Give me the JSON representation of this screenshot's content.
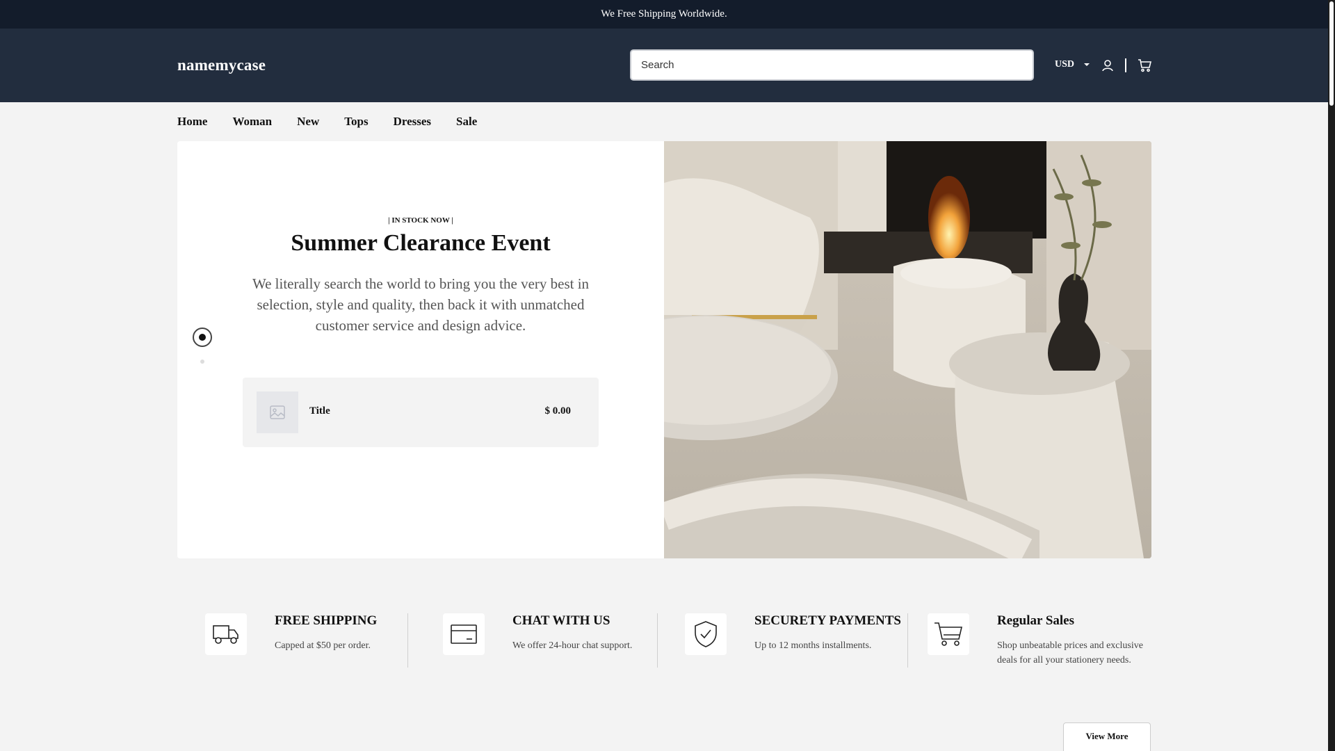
{
  "announcement": "We Free Shipping Worldwide.",
  "header": {
    "logo": "namemycase",
    "search_placeholder": "Search",
    "currency": "USD"
  },
  "nav": {
    "items": [
      "Home",
      "Woman",
      "New",
      "Tops",
      "Dresses",
      "Sale"
    ]
  },
  "hero": {
    "eyebrow": "| IN STOCK NOW |",
    "title": "Summer Clearance Event",
    "text": "We literally search the world to bring you the very best in selection, style and quality, then back it with unmatched customer service and design advice.",
    "product": {
      "title": "Title",
      "price": "$ 0.00"
    }
  },
  "features": [
    {
      "icon": "truck-icon",
      "title": "FREE SHIPPING",
      "desc": "Capped at $50 per order."
    },
    {
      "icon": "credit-card-icon",
      "title": "CHAT WITH US",
      "desc": "We offer 24-hour chat support."
    },
    {
      "icon": "shield-check-icon",
      "title": "SECURETY PAYMENTS",
      "desc": "Up to 12 months installments."
    },
    {
      "icon": "cart-icon",
      "title": "Regular Sales",
      "desc": "Shop unbeatable prices and exclusive deals for all your stationery needs."
    }
  ],
  "view_more": "View More",
  "colors": {
    "announcement_bg": "#131c2b",
    "header_bg": "#222d3e",
    "page_bg": "#f3f3f3"
  }
}
